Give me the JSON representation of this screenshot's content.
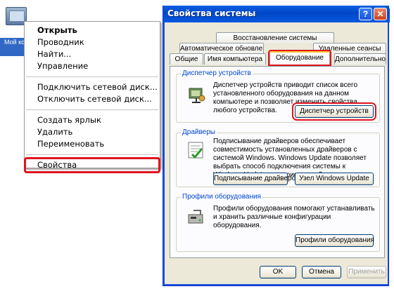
{
  "desktop": {
    "icon_label": "Мой компьютер"
  },
  "context_menu": {
    "items": [
      {
        "label": "Открыть"
      },
      {
        "label": "Проводник"
      },
      {
        "label": "Найти..."
      },
      {
        "label": "Управление"
      },
      {
        "label": "Подключить сетевой диск..."
      },
      {
        "label": "Отключить сетевой диск..."
      },
      {
        "label": "Создать ярлык"
      },
      {
        "label": "Удалить"
      },
      {
        "label": "Переименовать"
      },
      {
        "label": "Свойства"
      }
    ],
    "highlight_color": "#e0141e"
  },
  "dialog": {
    "title": "Свойства системы",
    "help_glyph": "?",
    "close_glyph": "✕",
    "tabs": [
      {
        "label": "Восстановление системы"
      },
      {
        "label": "Автоматическое обновление"
      },
      {
        "label": "Удаленные сеансы"
      },
      {
        "label": "Общие"
      },
      {
        "label": "Имя компьютера"
      },
      {
        "label": "Оборудование"
      },
      {
        "label": "Дополнительно"
      }
    ],
    "active_tab": "Оборудование",
    "groups": {
      "device_manager": {
        "title": "Диспетчер устройств",
        "text": "Диспетчер устройств приводит список всего установленного оборудования на данном компьютере и позволяет изменить свойства любого устройства.",
        "button": "Диспетчер устройств"
      },
      "drivers": {
        "title": "Драйверы",
        "text": "Подписывание драйверов обеспечивает совместимость установленных драйверов с системой Windows. Windows Update позволяет выбрать способ подключения системы к Windows Update для поиска драйверов.",
        "button_signing": "Подписывание драйверов",
        "button_update": "Узел Windows Update"
      },
      "profiles": {
        "title": "Профили оборудования",
        "text": "Профили оборудования помогают устанавливать и хранить различные конфигурации оборудования.",
        "button": "Профили оборудования"
      }
    },
    "footer": {
      "ok": "OK",
      "cancel": "Отмена",
      "apply": "Применить"
    }
  }
}
